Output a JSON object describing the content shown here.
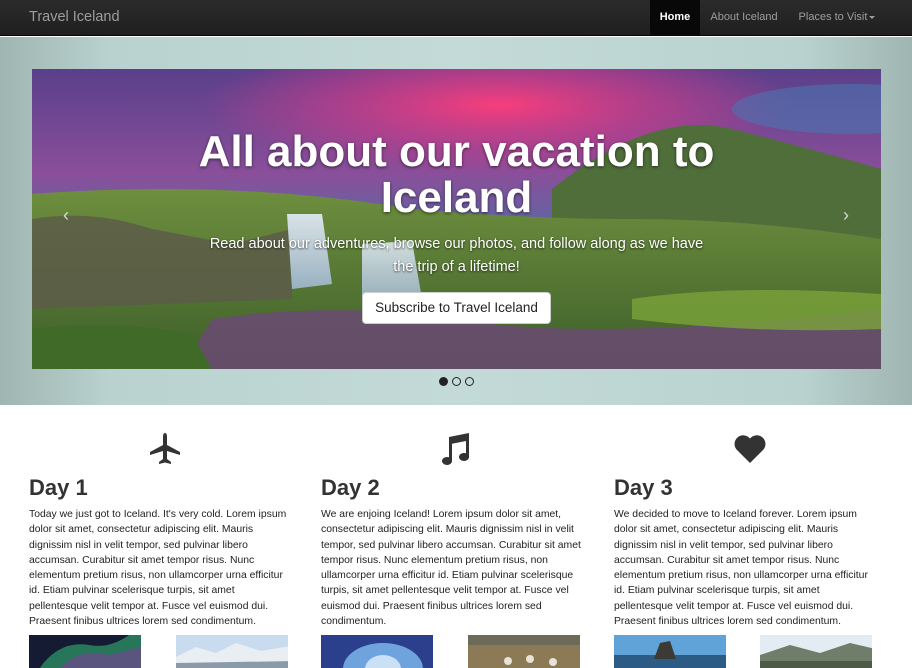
{
  "navbar": {
    "brand": "Travel Iceland",
    "items": [
      {
        "label": "Home"
      },
      {
        "label": "About Iceland"
      },
      {
        "label": "Places to Visit"
      }
    ]
  },
  "hero": {
    "title": "All about our vacation to Iceland",
    "subtitle": "Read about our adventures, browse our photos, and follow along as we have the trip of a lifetime!",
    "button_label": "Subscribe to Travel Iceland",
    "prev_icon": "‹",
    "next_icon": "›",
    "indicators": 3,
    "active_indicator": 1
  },
  "days": [
    {
      "title": "Day 1",
      "icon": "airplane-icon",
      "text": "Today we just got to Iceland. It's very cold. Lorem ipsum dolor sit amet, consectetur adipiscing elit. Mauris dignissim nisl in velit tempor, sed pulvinar libero accumsan. Curabitur sit amet tempor risus. Nunc elementum pretium risus, non ullamcorper urna efficitur id. Etiam pulvinar scelerisque turpis, sit amet pellentesque velit tempor at. Fusce vel euismod dui. Praesent finibus ultrices lorem sed condimentum."
    },
    {
      "title": "Day 2",
      "icon": "music-note-icon",
      "text": "We are enjoing Iceland! Lorem ipsum dolor sit amet, consectetur adipiscing elit. Mauris dignissim nisl in velit tempor, sed pulvinar libero accumsan. Curabitur sit amet tempor risus. Nunc elementum pretium risus, non ullamcorper urna efficitur id. Etiam pulvinar scelerisque turpis, sit amet pellentesque velit tempor at. Fusce vel euismod dui. Praesent finibus ultrices lorem sed condimentum."
    },
    {
      "title": "Day 3",
      "icon": "heart-icon",
      "text": "We decided to move to Iceland forever. Lorem ipsum dolor sit amet, consectetur adipiscing elit. Mauris dignissim nisl in velit tempor, sed pulvinar libero accumsan. Curabitur sit amet tempor risus. Nunc elementum pretium risus, non ullamcorper urna efficitur id. Etiam pulvinar scelerisque turpis, sit amet pellentesque velit tempor at. Fusce vel euismod dui. Praesent finibus ultrices lorem sed condimentum."
    }
  ],
  "colors": {
    "navbar": "#222222",
    "nav_text": "#9d9d9d",
    "hero_bg": "#c3dad8",
    "text": "#333333"
  }
}
